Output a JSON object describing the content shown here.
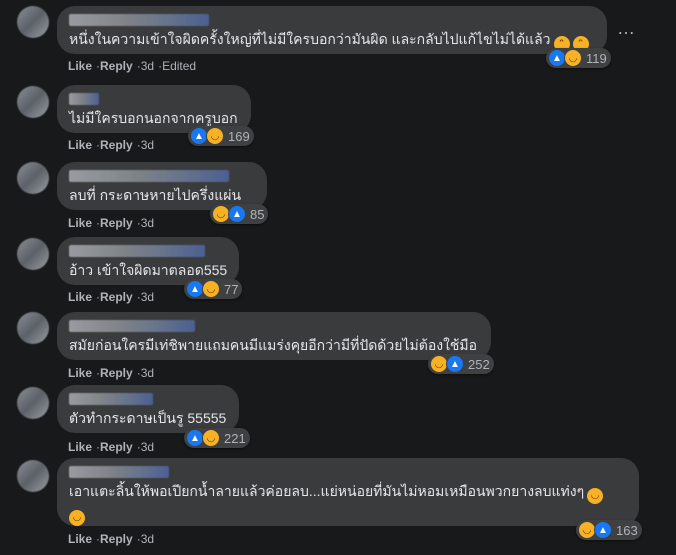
{
  "more_icon": "…",
  "comments": [
    {
      "text": "หนึ่งในความเข้าใจผิดครั้งใหญ่ที่ไม่มีใครบอกว่ามันผิด และกลับไปแก้ไขไม่ได้แล้ว",
      "count": "119",
      "like": "Like",
      "reply": "Reply",
      "time": "3d",
      "edited": "Edited"
    },
    {
      "text": "ไม่มีใครบอกนอกจากครูบอก",
      "count": "169",
      "like": "Like",
      "reply": "Reply",
      "time": "3d"
    },
    {
      "text": "ลบที่ กระดาษหายไปครึ่งแผ่น",
      "count": "85",
      "like": "Like",
      "reply": "Reply",
      "time": "3d"
    },
    {
      "text": "อ้าว เข้าใจผิดมาตลอด555",
      "count": "77",
      "like": "Like",
      "reply": "Reply",
      "time": "3d"
    },
    {
      "text": "สมัยก่อนใครมีเท่ชิพายแถมคนมีแมร่งคุยอีกว่ามีที่ปัดด้วยไม่ต้องใช้มือ",
      "count": "252",
      "like": "Like",
      "reply": "Reply",
      "time": "3d"
    },
    {
      "text": "ตัวทำกระดาษเป็นรู 55555",
      "count": "221",
      "like": "Like",
      "reply": "Reply",
      "time": "3d"
    },
    {
      "text": "เอาแตะลิ้นให้พอเปียกน้ำลายแล้วค่อยลบ...แย่หน่อยที่มันไม่หอมเหมือนพวกยางลบแท่งๆ",
      "count": "163",
      "like": "Like",
      "reply": "Reply",
      "time": "3d"
    }
  ]
}
